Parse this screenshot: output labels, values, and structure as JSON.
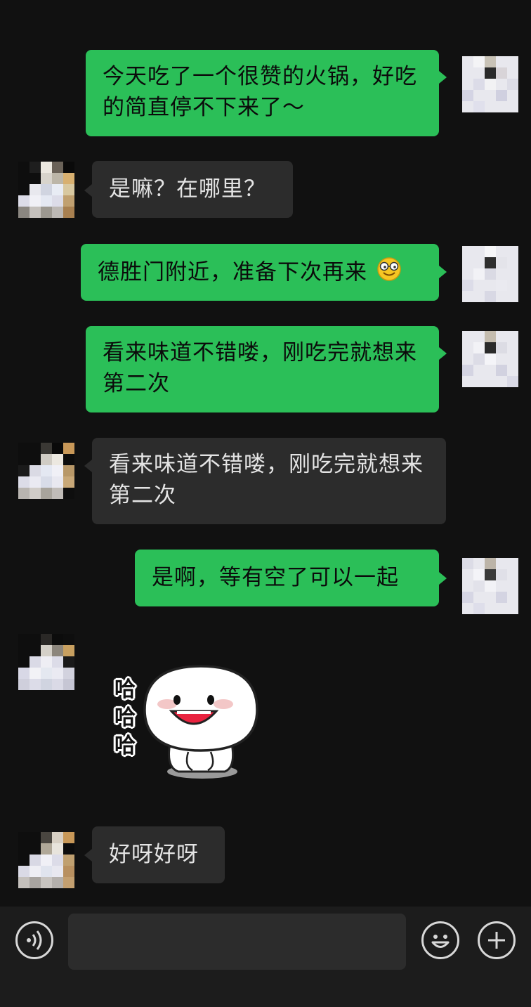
{
  "messages": [
    {
      "side": "me",
      "text": "今天吃了一个很赞的火锅，好吃的简直停不下来了～"
    },
    {
      "side": "other",
      "text": "是嘛？在哪里？"
    },
    {
      "side": "me",
      "text": "德胜门附近，准备下次再来",
      "emoji": "grinning-face-with-glasses"
    },
    {
      "side": "me",
      "text": "看来味道不错喽，刚吃完就想来第二次"
    },
    {
      "side": "other",
      "text": "看来味道不错喽，刚吃完就想来第二次"
    },
    {
      "side": "me",
      "text": "是啊，等有空了可以一起"
    },
    {
      "side": "other",
      "type": "sticker",
      "sticker_text": [
        "哈",
        "哈",
        "哈"
      ],
      "sticker": "laughing-dumpling-sticker"
    },
    {
      "side": "other",
      "text": "好呀好呀"
    }
  ],
  "toolbar": {
    "voice_icon": "voice-icon",
    "input_value": "",
    "emoji_icon": "emoji-icon",
    "plus_icon": "plus-icon"
  },
  "colors": {
    "background": "#111111",
    "my_bubble": "#2bbf58",
    "their_bubble": "#2c2c2c",
    "toolbar": "#1c1c1c"
  }
}
